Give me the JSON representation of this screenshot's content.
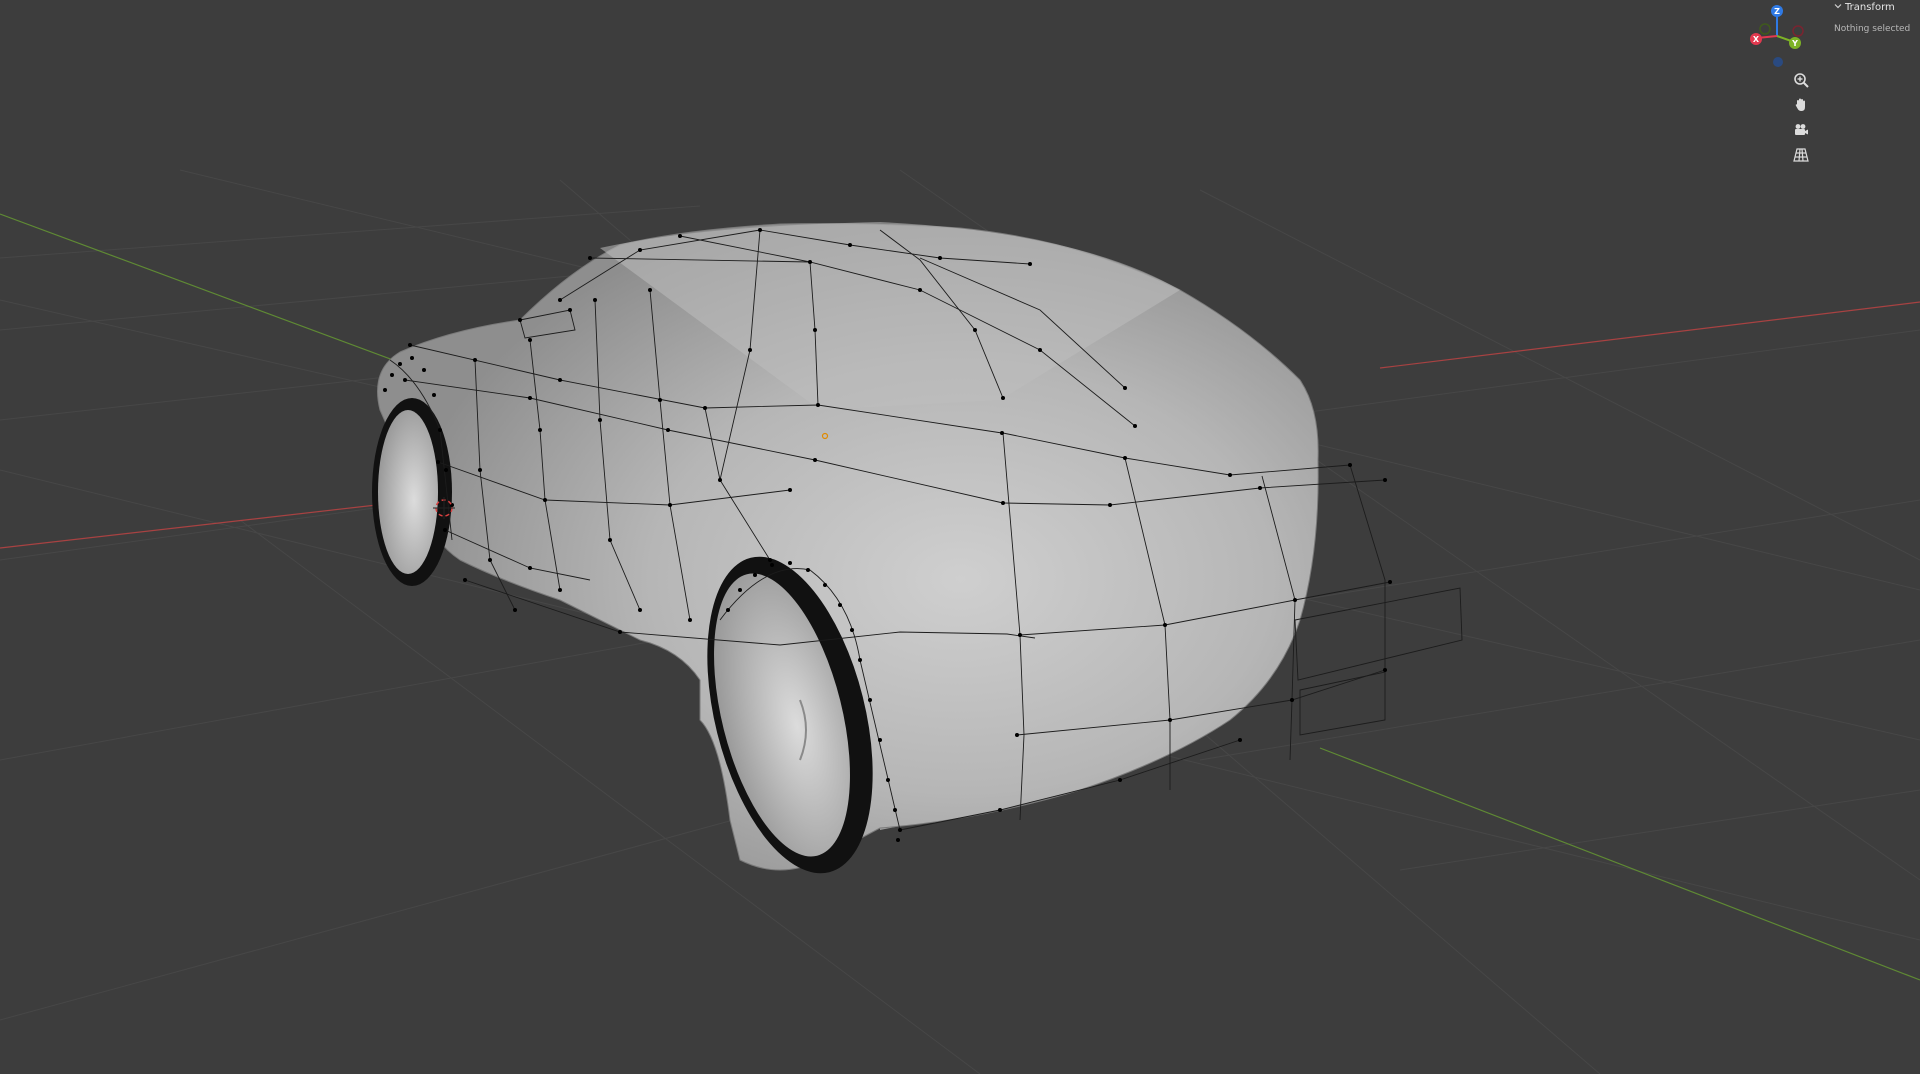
{
  "app": "Blender",
  "viewport": {
    "mode": "Edit Mode",
    "object": "car mesh",
    "background_color": "#3d3d3d"
  },
  "gizmo": {
    "axes": [
      {
        "label": "Z",
        "color": "#2f7ae5"
      },
      {
        "label": "Y",
        "color": "#7db226"
      },
      {
        "label": "X",
        "color": "#e2394f"
      }
    ],
    "negative_axis_colors": [
      "#7a2430",
      "#3f5a1c",
      "#2a4a80"
    ]
  },
  "nav_buttons": [
    {
      "name": "zoom",
      "icon": "magnifier-plus-icon"
    },
    {
      "name": "pan",
      "icon": "hand-icon"
    },
    {
      "name": "camera",
      "icon": "camera-icon"
    },
    {
      "name": "perspective",
      "icon": "grid-perspective-icon"
    }
  ],
  "sidebar": {
    "panel_title": "Transform",
    "status_text": "Nothing selected"
  },
  "colors": {
    "x_axis_line": "#b84545",
    "y_axis_line": "#6e9a3a",
    "grid": "#4a4a4a",
    "body_fill": "#b2b2b2",
    "tire": "#111111",
    "wireframe": "#1a1a1a",
    "vertex": "#000000",
    "origin_dot": "#e08a00",
    "cursor_red": "#d94040"
  }
}
